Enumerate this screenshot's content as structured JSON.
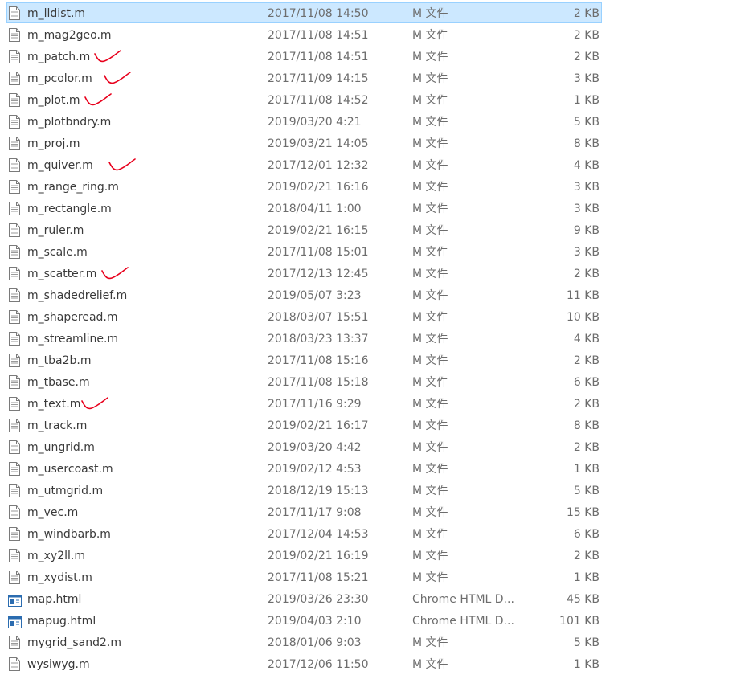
{
  "files": [
    {
      "name": "m_lldist.m",
      "date": "2017/11/08 14:50",
      "type": "M 文件",
      "size": "2 KB",
      "icon": "document-icon",
      "selected": true
    },
    {
      "name": "m_mag2geo.m",
      "date": "2017/11/08 14:51",
      "type": "M 文件",
      "size": "2 KB",
      "icon": "document-icon"
    },
    {
      "name": "m_patch.m",
      "date": "2017/11/08 14:51",
      "type": "M 文件",
      "size": "2 KB",
      "icon": "document-icon",
      "marked": true
    },
    {
      "name": "m_pcolor.m",
      "date": "2017/11/09 14:15",
      "type": "M 文件",
      "size": "3 KB",
      "icon": "document-icon",
      "marked": true
    },
    {
      "name": "m_plot.m",
      "date": "2017/11/08 14:52",
      "type": "M 文件",
      "size": "1 KB",
      "icon": "document-icon",
      "marked": true
    },
    {
      "name": "m_plotbndry.m",
      "date": "2019/03/20 4:21",
      "type": "M 文件",
      "size": "5 KB",
      "icon": "document-icon"
    },
    {
      "name": "m_proj.m",
      "date": "2019/03/21 14:05",
      "type": "M 文件",
      "size": "8 KB",
      "icon": "document-icon"
    },
    {
      "name": "m_quiver.m",
      "date": "2017/12/01 12:32",
      "type": "M 文件",
      "size": "4 KB",
      "icon": "document-icon",
      "marked": true
    },
    {
      "name": "m_range_ring.m",
      "date": "2019/02/21 16:16",
      "type": "M 文件",
      "size": "3 KB",
      "icon": "document-icon"
    },
    {
      "name": "m_rectangle.m",
      "date": "2018/04/11 1:00",
      "type": "M 文件",
      "size": "3 KB",
      "icon": "document-icon"
    },
    {
      "name": "m_ruler.m",
      "date": "2019/02/21 16:15",
      "type": "M 文件",
      "size": "9 KB",
      "icon": "document-icon"
    },
    {
      "name": "m_scale.m",
      "date": "2017/11/08 15:01",
      "type": "M 文件",
      "size": "3 KB",
      "icon": "document-icon"
    },
    {
      "name": "m_scatter.m",
      "date": "2017/12/13 12:45",
      "type": "M 文件",
      "size": "2 KB",
      "icon": "document-icon",
      "marked": true
    },
    {
      "name": "m_shadedrelief.m",
      "date": "2019/05/07 3:23",
      "type": "M 文件",
      "size": "11 KB",
      "icon": "document-icon"
    },
    {
      "name": "m_shaperead.m",
      "date": "2018/03/07 15:51",
      "type": "M 文件",
      "size": "10 KB",
      "icon": "document-icon"
    },
    {
      "name": "m_streamline.m",
      "date": "2018/03/23 13:37",
      "type": "M 文件",
      "size": "4 KB",
      "icon": "document-icon"
    },
    {
      "name": "m_tba2b.m",
      "date": "2017/11/08 15:16",
      "type": "M 文件",
      "size": "2 KB",
      "icon": "document-icon"
    },
    {
      "name": "m_tbase.m",
      "date": "2017/11/08 15:18",
      "type": "M 文件",
      "size": "6 KB",
      "icon": "document-icon"
    },
    {
      "name": "m_text.m",
      "date": "2017/11/16 9:29",
      "type": "M 文件",
      "size": "2 KB",
      "icon": "document-icon",
      "marked": true
    },
    {
      "name": "m_track.m",
      "date": "2019/02/21 16:17",
      "type": "M 文件",
      "size": "8 KB",
      "icon": "document-icon"
    },
    {
      "name": "m_ungrid.m",
      "date": "2019/03/20 4:42",
      "type": "M 文件",
      "size": "2 KB",
      "icon": "document-icon"
    },
    {
      "name": "m_usercoast.m",
      "date": "2019/02/12 4:53",
      "type": "M 文件",
      "size": "1 KB",
      "icon": "document-icon"
    },
    {
      "name": "m_utmgrid.m",
      "date": "2018/12/19 15:13",
      "type": "M 文件",
      "size": "5 KB",
      "icon": "document-icon"
    },
    {
      "name": "m_vec.m",
      "date": "2017/11/17 9:08",
      "type": "M 文件",
      "size": "15 KB",
      "icon": "document-icon"
    },
    {
      "name": "m_windbarb.m",
      "date": "2017/12/04 14:53",
      "type": "M 文件",
      "size": "6 KB",
      "icon": "document-icon"
    },
    {
      "name": "m_xy2ll.m",
      "date": "2019/02/21 16:19",
      "type": "M 文件",
      "size": "2 KB",
      "icon": "document-icon"
    },
    {
      "name": "m_xydist.m",
      "date": "2017/11/08 15:21",
      "type": "M 文件",
      "size": "1 KB",
      "icon": "document-icon"
    },
    {
      "name": "map.html",
      "date": "2019/03/26 23:30",
      "type": "Chrome HTML D...",
      "size": "45 KB",
      "icon": "html-file-icon"
    },
    {
      "name": "mapug.html",
      "date": "2019/04/03 2:10",
      "type": "Chrome HTML D...",
      "size": "101 KB",
      "icon": "html-file-icon"
    },
    {
      "name": "mygrid_sand2.m",
      "date": "2018/01/06 9:03",
      "type": "M 文件",
      "size": "5 KB",
      "icon": "document-icon"
    },
    {
      "name": "wysiwyg.m",
      "date": "2017/12/06 11:50",
      "type": "M 文件",
      "size": "1 KB",
      "icon": "document-icon"
    }
  ],
  "colors": {
    "selection_fill": "#cce8ff",
    "selection_border": "#99d1ff",
    "annotation_mark": "#e8001c"
  }
}
